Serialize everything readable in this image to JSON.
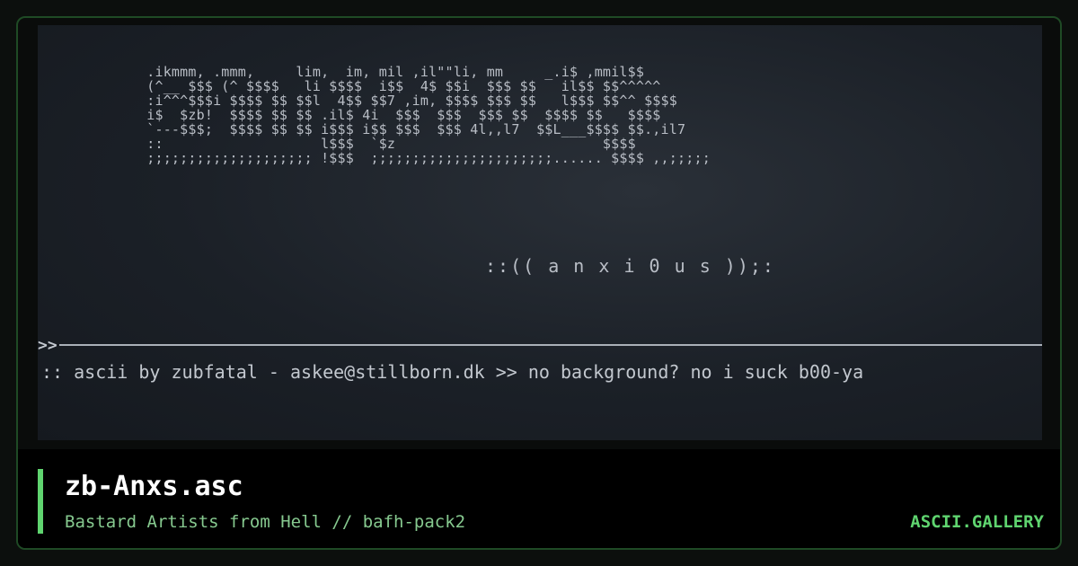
{
  "artwork": {
    "ascii_lines": [
      " .ikmmm, .mmm,     lim,  im, mil ,il\"\"li, mm     _.i$ ,mmil$$",
      " (^__ $$$ (^ $$$$   li $$$$  i$$  4$ $$i  $$$ $$   il$$ $$^^^^^",
      " :i^^^$$$i $$$$ $$ $$l  4$$ $$7 ,im, $$$$ $$$ $$   l$$$ $$^^ $$$$",
      " i$  $zb!  $$$$ $$ $$ .il$ 4i  $$$  $$$  $$$ $$  $$$$ $$   $$$$",
      " `---$$$;  $$$$ $$ $$ i$$$ i$$ $$$  $$$ 4l,,l7  $$L___$$$$ $$.,il7",
      " ::                   l$$$  `$z                         $$$$",
      " ;;;;;;;;;;;;;;;;;;;; !$$$  ;;;;;;;;;;;;;;;;;;;;;;...... $$$$ ,,;;;;;"
    ],
    "tagline": "::(( a n x i 0 u s ));:",
    "divider_arrow": ">>",
    "credit": ":: ascii by zubfatal - askee@stillborn.dk >> no background? no i suck b00-ya"
  },
  "footer": {
    "title": "zb-Anxs.asc",
    "meta": "Bastard Artists from Hell // bafh-pack2",
    "brand": "ASCII.GALLERY"
  },
  "colors": {
    "accent": "#5fd46f",
    "border": "#1f4a25",
    "art_text": "#b9bec6"
  }
}
